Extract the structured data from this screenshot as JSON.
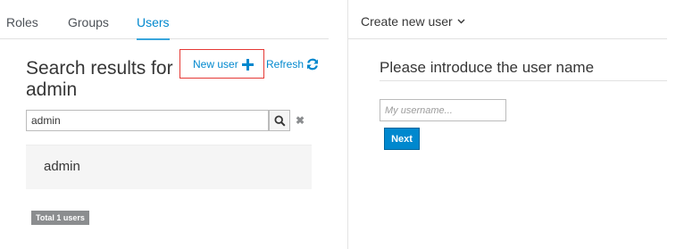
{
  "tabs": [
    {
      "label": "Roles",
      "active": false
    },
    {
      "label": "Groups",
      "active": false
    },
    {
      "label": "Users",
      "active": true
    }
  ],
  "search": {
    "title": "Search results for admin",
    "value": "admin",
    "new_user_label": "New user",
    "refresh_label": "Refresh"
  },
  "results": [
    {
      "label": "admin"
    }
  ],
  "total_label": "Total 1 users",
  "create": {
    "dropdown_label": "Create new user",
    "form_title": "Please introduce the user name",
    "username_placeholder": "My username...",
    "next_label": "Next"
  },
  "colors": {
    "accent": "#0088ce",
    "highlight_border": "#e53935",
    "badge": "#8b8d8f"
  },
  "icons": [
    "plus-icon",
    "refresh-icon",
    "search-icon",
    "close-icon",
    "chevron-down-icon"
  ]
}
